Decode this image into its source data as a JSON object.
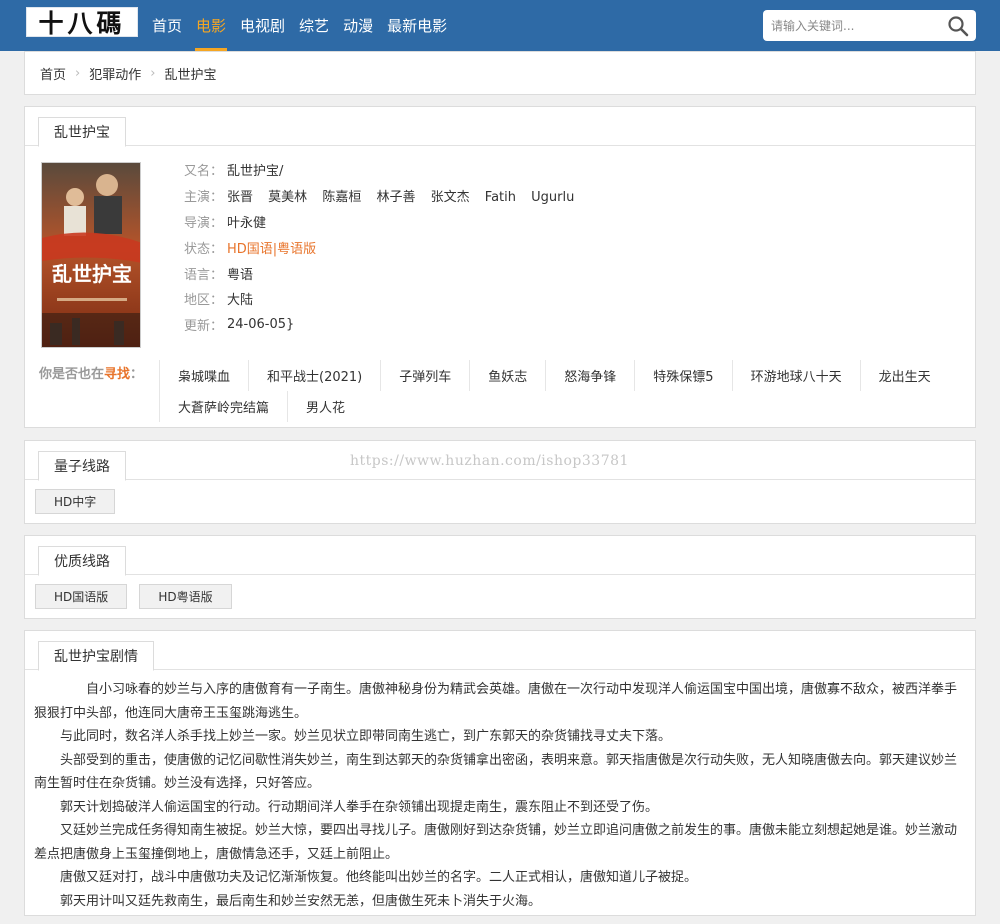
{
  "header": {
    "logo_text": "十八碼",
    "nav": [
      {
        "label": "首页",
        "active": false
      },
      {
        "label": "电影",
        "active": true
      },
      {
        "label": "电视剧",
        "active": false
      },
      {
        "label": "综艺",
        "active": false
      },
      {
        "label": "动漫",
        "active": false
      },
      {
        "label": "最新电影",
        "active": false
      }
    ],
    "search_placeholder": "请输入关键词...",
    "search_icon": "search-icon",
    "colors": {
      "bar": "#2e6aa6",
      "accent": "#f5a623"
    }
  },
  "breadcrumb": [
    "首页",
    "犯罪动作",
    "乱世护宝"
  ],
  "detail": {
    "tab": "乱世护宝",
    "poster_title": "乱世护宝",
    "alias_label": "又名：",
    "alias": "乱世护宝/",
    "cast_label": "主演：",
    "cast": [
      "张晋",
      "莫美林",
      "陈嘉桓",
      "林子善",
      "张文杰",
      "Fatih",
      "Ugurlu"
    ],
    "director_label": "导演：",
    "director": "叶永健",
    "status_label": "状态：",
    "status": "HD国语|粤语版",
    "language_label": "语言：",
    "language": "粤语",
    "region_label": "地区：",
    "region": "大陆",
    "update_label": "更新：",
    "update": "24-06-05}",
    "related_prefix": "你是否也在",
    "related_highlight": "寻找",
    "related_suffix": "：",
    "related": [
      "枭城喋血",
      "和平战士(2021)",
      "子弹列车",
      "鱼妖志",
      "怒海争锋",
      "特殊保镖5",
      "环游地球八十天",
      "龙出生天",
      "大蒼萨岭完结篇",
      "男人花"
    ]
  },
  "line1": {
    "tab": "量子线路",
    "buttons": [
      "HD中字"
    ]
  },
  "line2": {
    "tab": "优质线路",
    "buttons": [
      "HD国语版",
      "HD粤语版"
    ]
  },
  "watermark": "https://www.huzhan.com/ishop33781",
  "plot": {
    "tab": "乱世护宝剧情",
    "paragraphs": [
      "自小习咏春的妙兰与入序的唐傲育有一子南生。唐傲神秘身份为精武会英雄。唐傲在一次行动中发现洋人偷运国宝中国出境，唐傲寡不敌众，被西洋拳手狠狠打中头部，他连同大唐帝王玉玺跳海逃生。",
      "与此同时，数名洋人杀手找上妙兰一家。妙兰见状立即带同南生逃亡，到广东郭天的杂货铺找寻丈夫下落。",
      "头部受到的重击，使唐傲的记忆间歇性消失妙兰，南生到达郭天的杂货铺拿出密函，表明来意。郭天指唐傲是次行动失败，无人知晓唐傲去向。郭天建议妙兰南生暂时住在杂货铺。妙兰没有选择，只好答应。",
      "郭天计划捣破洋人偷运国宝的行动。行动期间洋人拳手在杂领铺出现提走南生，震东阻止不到还受了伤。",
      "又廷妙兰完成任务得知南生被捉。妙兰大惊，要四出寻找儿子。唐傲刚好到达杂货铺，妙兰立即追问唐傲之前发生的事。唐傲未能立刻想起她是谁。妙兰激动差点把唐傲身上玉玺撞倒地上，唐傲情急还手，又廷上前阻止。",
      "唐傲又廷对打，战斗中唐傲功夫及记忆渐渐恢复。他终能叫出妙兰的名字。二人正式相认，唐傲知道儿子被捉。",
      "郭天用计叫又廷先救南生，最后南生和妙兰安然无恙，但唐傲生死未卜消失于火海。"
    ]
  }
}
